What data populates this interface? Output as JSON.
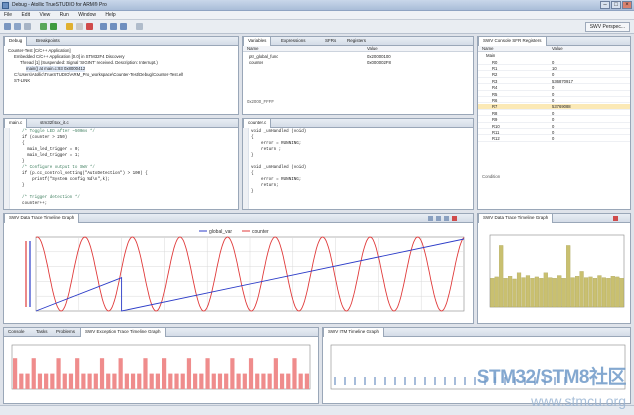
{
  "window": {
    "title": "Debug - Atollic TrueSTUDIO for ARM® Pro"
  },
  "menu": [
    "File",
    "Edit",
    "View",
    "Run",
    "Window",
    "Help"
  ],
  "toolbar": {
    "perspective_label": "SWV Perspec..."
  },
  "debug_view": {
    "tabs": [
      "Debug",
      "Breakpoints"
    ],
    "rows": [
      "Counter-Test [C/C++ Application]",
      "Embedded C/C++ Application [0.0] in STM32F4 Discovery",
      "Thread [1] (Suspended: Signal 'SIGINT' received. Description: Interrupt.)",
      "main() at main.c:93 0x8000412",
      "C:\\Users\\Atollic\\TrueSTUDIO\\ARM_Pro_workspace\\Counter-Test\\Debug\\Counter-Test.elf",
      "ST-LINK"
    ]
  },
  "variables_view": {
    "tabs": [
      "Variables",
      "Expressions",
      "SFRs",
      "Registers"
    ],
    "headers": [
      "Name",
      "Value"
    ],
    "rows": [
      {
        "name": "ptr_global_func",
        "value": "0x20000100"
      },
      {
        "name": "counter",
        "value": "0x000002F8"
      }
    ],
    "footer": "0x2000_FFFF"
  },
  "swv_registers": {
    "title": "SWV Console SFR Registers",
    "headers": [
      "Name",
      "Value"
    ],
    "group": "Main",
    "rows": [
      {
        "name": "R0",
        "value": "0"
      },
      {
        "name": "R1",
        "value": "10"
      },
      {
        "name": "R2",
        "value": "0"
      },
      {
        "name": "R3",
        "value": "536870917"
      },
      {
        "name": "R4",
        "value": "0"
      },
      {
        "name": "R5",
        "value": "0"
      },
      {
        "name": "R6",
        "value": "0"
      },
      {
        "name": "R7",
        "value": "53769088"
      },
      {
        "name": "R8",
        "value": "0"
      },
      {
        "name": "R9",
        "value": "0"
      },
      {
        "name": "R10",
        "value": "0"
      },
      {
        "name": "R11",
        "value": "0"
      },
      {
        "name": "R12",
        "value": "0"
      }
    ],
    "footer": "Condition"
  },
  "editor_left": {
    "tabs": [
      "main.c",
      "stm32f4xx_it.c"
    ],
    "lines": [
      {
        "t": "    /* Toggle LED after ~500ms */",
        "c": "cm"
      },
      {
        "t": "    if (counter > 250)",
        "c": ""
      },
      {
        "t": "    {",
        "c": ""
      },
      {
        "t": "      main_led_trigger = 0;",
        "c": ""
      },
      {
        "t": "      main_led_trigger = 1;",
        "c": ""
      },
      {
        "t": "    }",
        "c": ""
      },
      {
        "t": "    /* Configure output to SWV */",
        "c": "cm"
      },
      {
        "t": "    if (p.cc_control_setting(\"AutoDetection\") > 100) {",
        "c": ""
      },
      {
        "t": "        printf(\"System config %d\\n\",k);",
        "c": ""
      },
      {
        "t": "    }",
        "c": ""
      },
      {
        "t": "",
        "c": ""
      },
      {
        "t": "    /* Trigger detection */",
        "c": "cm"
      },
      {
        "t": "    counter++;",
        "c": ""
      }
    ]
  },
  "editor_right": {
    "tabs": [
      "counter.c"
    ],
    "lines": [
      {
        "t": "void _unHandled (void)",
        "c": ""
      },
      {
        "t": "{",
        "c": ""
      },
      {
        "t": "    error = RUNNING;",
        "c": ""
      },
      {
        "t": "    return ;",
        "c": ""
      },
      {
        "t": "}",
        "c": ""
      },
      {
        "t": "",
        "c": ""
      },
      {
        "t": "void _unHandled (void)",
        "c": ""
      },
      {
        "t": "{",
        "c": ""
      },
      {
        "t": "    error = RUNNING;",
        "c": ""
      },
      {
        "t": "    return;",
        "c": ""
      },
      {
        "t": "}",
        "c": ""
      }
    ]
  },
  "timeline_main": {
    "title": "SWV Data Trace Timeline Graph",
    "legend": [
      "global_var",
      "counter"
    ]
  },
  "timeline_small": {
    "title": "SWV Data Trace Timeline Graph"
  },
  "bottom_left": {
    "tabs": [
      "Console",
      "Tasks",
      "Problems",
      "SWV Exception Trace Timeline Graph"
    ]
  },
  "bottom_right": {
    "tabs": [
      "SWV ITM Timeline Graph"
    ]
  },
  "watermark": {
    "line1": "STM32/STM8社区",
    "line2": "www.stmcu.org"
  },
  "colors": {
    "sine": "#e03b3b",
    "ramp": "#2c3cc8",
    "bars": "#c9c070",
    "pulse": "#ef8c8c"
  },
  "chart_data": [
    {
      "type": "line",
      "title": "SWV Data Trace Timeline Graph",
      "series": [
        {
          "name": "global_var",
          "shape": "sine",
          "periods": 9,
          "min": 0,
          "max": 1
        },
        {
          "name": "counter",
          "shape": "sawtooth",
          "reset_at": 0.2,
          "min": 0,
          "max": 1
        }
      ],
      "xlim": [
        0,
        1
      ],
      "ylim": [
        0,
        1
      ],
      "grid": true,
      "legend": "top-center"
    },
    {
      "type": "bar",
      "title": "SWV Data Trace Timeline Graph",
      "values": [
        0.42,
        0.44,
        0.9,
        0.42,
        0.45,
        0.41,
        0.5,
        0.43,
        0.46,
        0.42,
        0.44,
        0.42,
        0.5,
        0.43,
        0.42,
        0.46,
        0.42,
        0.9,
        0.43,
        0.45,
        0.52,
        0.43,
        0.44,
        0.42,
        0.46,
        0.43,
        0.42,
        0.45,
        0.44,
        0.42
      ],
      "ylim": [
        0,
        1
      ]
    },
    {
      "type": "bar",
      "title": "SWV Exception Trace Timeline Graph",
      "values": [
        1,
        0.5,
        0.5,
        1,
        0.5,
        0.5,
        0.5,
        1,
        0.5,
        0.5,
        1,
        0.5,
        0.5,
        0.5,
        1,
        0.5,
        0.5,
        1,
        0.5,
        0.5,
        0.5,
        1,
        0.5,
        0.5,
        1,
        0.5,
        0.5,
        0.5,
        1,
        0.5,
        0.5,
        1,
        0.5,
        0.5,
        0.5,
        1,
        0.5,
        0.5,
        1,
        0.5,
        0.5,
        0.5,
        1,
        0.5,
        0.5,
        1,
        0.5,
        0.5
      ],
      "ylim": [
        0,
        1
      ]
    }
  ]
}
